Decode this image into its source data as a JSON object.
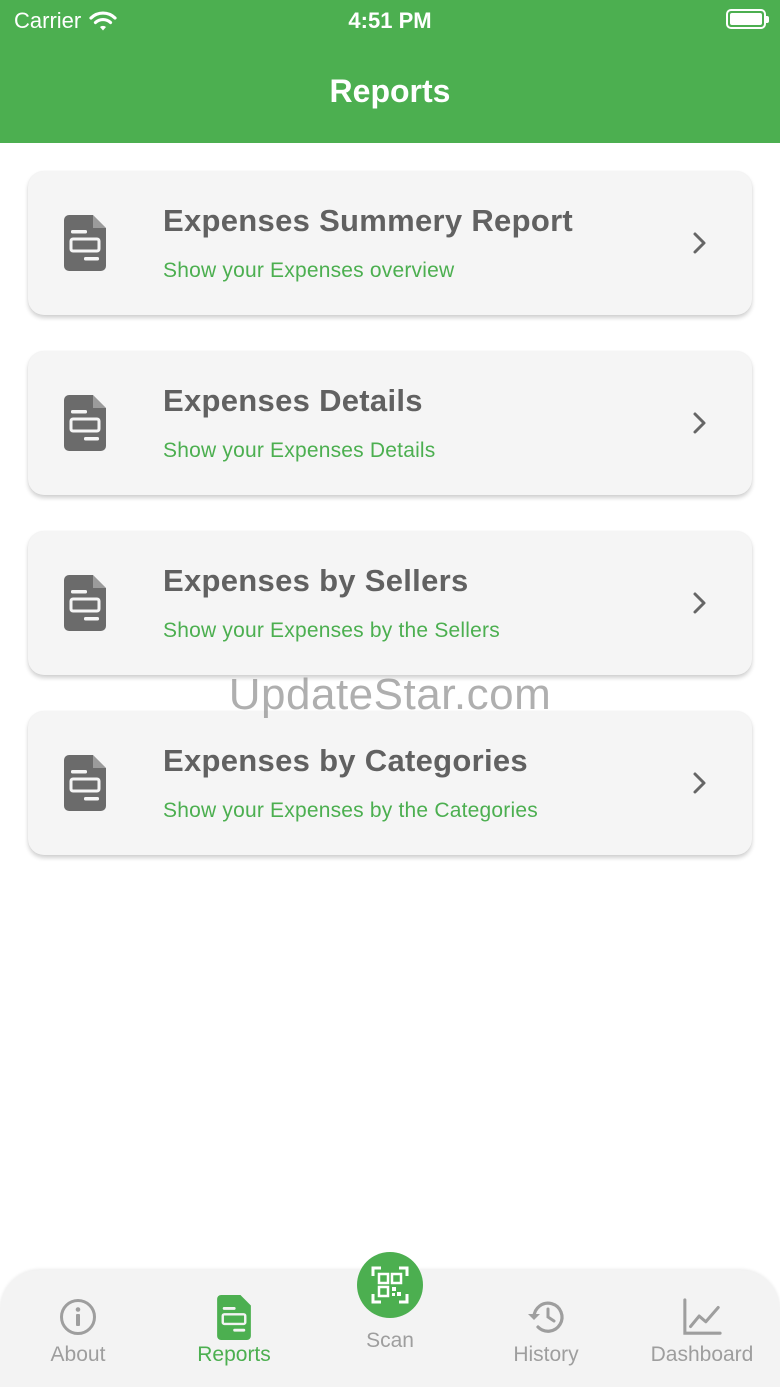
{
  "status_bar": {
    "carrier": "Carrier",
    "time": "4:51 PM"
  },
  "header": {
    "title": "Reports"
  },
  "reports": [
    {
      "title": "Expenses Summery Report",
      "subtitle": "Show your Expenses overview"
    },
    {
      "title": "Expenses Details",
      "subtitle": "Show your Expenses Details"
    },
    {
      "title": "Expenses by Sellers",
      "subtitle": "Show your Expenses by the Sellers"
    },
    {
      "title": "Expenses by Categories",
      "subtitle": "Show your Expenses by the Categories"
    }
  ],
  "watermark": "UpdateStar.com",
  "bottom_nav": {
    "about": "About",
    "reports": "Reports",
    "scan": "Scan",
    "history": "History",
    "dashboard": "Dashboard"
  },
  "colors": {
    "primary": "#4caf50",
    "card_bg": "#f5f5f5",
    "title_text": "#616161",
    "inactive": "#9e9e9e"
  }
}
